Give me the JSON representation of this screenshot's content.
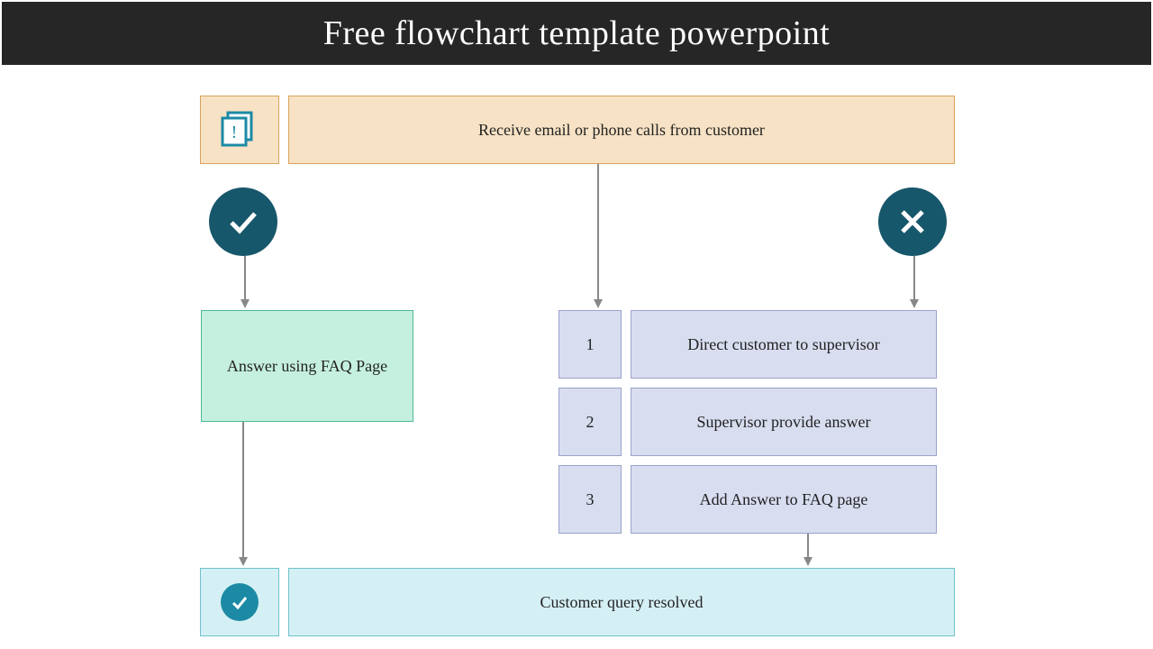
{
  "title": "Free flowchart template powerpoint",
  "start": {
    "label": "Receive email or phone calls from customer"
  },
  "left_path": {
    "answer": "Answer using FAQ Page"
  },
  "right_path": {
    "steps": [
      {
        "num": "1",
        "text": "Direct customer to supervisor"
      },
      {
        "num": "2",
        "text": "Supervisor provide answer"
      },
      {
        "num": "3",
        "text": "Add Answer to FAQ page"
      }
    ]
  },
  "end": {
    "label": "Customer query resolved"
  },
  "colors": {
    "teal": "#17576b",
    "orange_fill": "#f7e2c5",
    "blue_fill": "#d8ddf0",
    "green_fill": "#c5f0df",
    "cyan_fill": "#d5f0f5"
  }
}
